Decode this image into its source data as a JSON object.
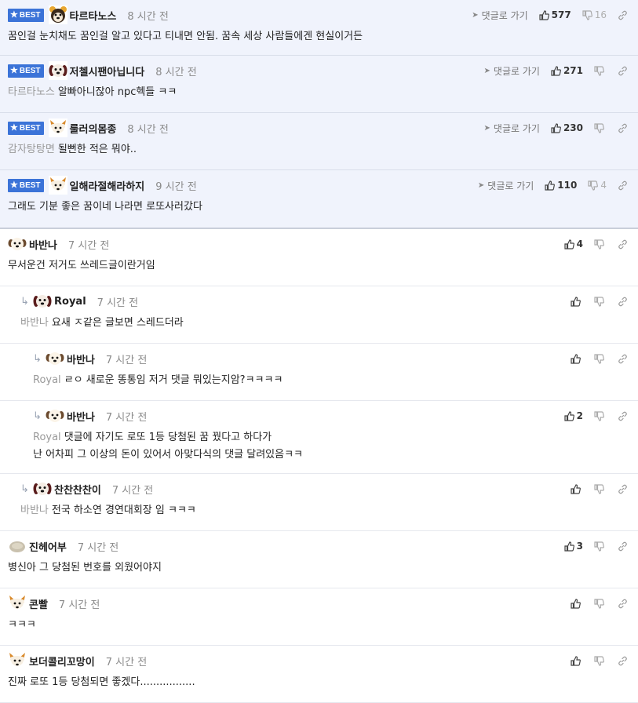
{
  "labels": {
    "best": "BEST",
    "go_reply": "댓글로 가기"
  },
  "colors": {
    "best_bg": "#f0f3fc",
    "badge": "#3b73d8"
  },
  "comments": [
    {
      "nick": "타르타노스",
      "time": "8 시간 전",
      "up": "577",
      "down": "16",
      "to": "",
      "lines": [
        "꿈인걸 눈치채도 꿈인걸 알고 있다고 티내면 안됨. 꿈속 세상 사람들에겐 현실이거든"
      ],
      "avatar": "bear-avatar-icon"
    },
    {
      "nick": "저첼시팬아닙니다",
      "time": "8 시간 전",
      "up": "271",
      "down": "",
      "to": "타르타노스",
      "lines": [
        "알빠아니잖아 npc헥들 ㅋㅋ"
      ],
      "avatar": "puppy-avatar-icon"
    },
    {
      "nick": "룰러의몸종",
      "time": "8 시간 전",
      "up": "230",
      "down": "",
      "to": "감자탕탕면",
      "lines": [
        "될뻔한 적은 뭐야.."
      ],
      "avatar": "fox-avatar-icon"
    },
    {
      "nick": "일해라절해라하지",
      "time": "9 시간 전",
      "up": "110",
      "down": "4",
      "to": "",
      "lines": [
        "그래도 기분 좋은 꿈이네 나라면 로또사러갔다"
      ],
      "avatar": "fox-avatar-icon"
    },
    {
      "nick": "바반나",
      "time": "7 시간 전",
      "up": "4",
      "down": "",
      "to": "",
      "lines": [
        "무서운건 저거도 쓰레드글이란거임"
      ],
      "avatar": "dog-avatar-icon"
    },
    {
      "nick": "Royal",
      "time": "7 시간 전",
      "up": "",
      "down": "",
      "to": "바반나",
      "lines": [
        "요새 ㅈ같은 글보면 스레드더라"
      ],
      "avatar": "puppy-avatar-icon"
    },
    {
      "nick": "바반나",
      "time": "7 시간 전",
      "up": "",
      "down": "",
      "to": "Royal",
      "lines": [
        "ㄹㅇ 새로운 똥통임 저거 댓글 뭐있는지암?ㅋㅋㅋㅋ"
      ],
      "avatar": "dog-avatar-icon"
    },
    {
      "nick": "바반나",
      "time": "7 시간 전",
      "up": "2",
      "down": "",
      "to": "Royal",
      "lines": [
        "댓글에 자기도 로또 1등 당첨된 꿈 꿨다고 하다가",
        "난 어차피 그 이상의 돈이 있어서 아맞다식의 댓글 달려있음ㅋㅋ"
      ],
      "avatar": "dog-avatar-icon"
    },
    {
      "nick": "찬찬찬찬이",
      "time": "7 시간 전",
      "up": "",
      "down": "",
      "to": "바반나",
      "lines": [
        "전국 하소연 경연대회장 임 ㅋㅋㅋ"
      ],
      "avatar": "puppy-avatar-icon"
    },
    {
      "nick": "진헤어부",
      "time": "7 시간 전",
      "up": "3",
      "down": "",
      "to": "",
      "lines": [
        "병신아 그 당첨된 번호를 외웠어야지"
      ],
      "avatar": "blob-avatar-icon"
    },
    {
      "nick": "콘빨",
      "time": "7 시간 전",
      "up": "",
      "down": "",
      "to": "",
      "lines": [
        "ㅋㅋㅋ"
      ],
      "avatar": "fox-avatar-icon"
    },
    {
      "nick": "보더콜리꼬망이",
      "time": "7 시간 전",
      "up": "",
      "down": "",
      "to": "",
      "lines": [
        "진짜 로또 1등 당첨되면 좋겠다................."
      ],
      "avatar": "fox-avatar-icon"
    }
  ]
}
